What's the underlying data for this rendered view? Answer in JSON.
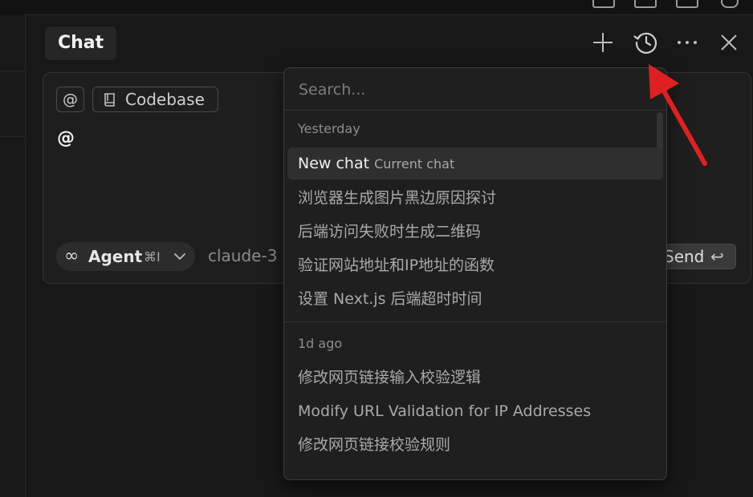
{
  "header": {
    "tab_title": "Chat",
    "icons": [
      "plus-icon",
      "history-icon",
      "more-icon",
      "close-icon"
    ]
  },
  "composer": {
    "mention_chip": "@",
    "codebase_chip": "Codebase",
    "typed_text": "@",
    "agent": {
      "label": "Agent",
      "shortcut": "⌘I"
    },
    "model": "claude-3",
    "send_label": "Send",
    "send_icon": "↩"
  },
  "history": {
    "search_placeholder": "Search...",
    "sections": [
      {
        "title": "Yesterday",
        "items": [
          {
            "label": "New chat",
            "sub": "Current chat"
          },
          {
            "label": "浏览器生成图片黑边原因探讨"
          },
          {
            "label": "后端访问失败时生成二维码"
          },
          {
            "label": "验证网站地址和IP地址的函数"
          },
          {
            "label": "设置 Next.js 后端超时时间"
          }
        ]
      },
      {
        "title": "1d ago",
        "items": [
          {
            "label": "修改网页链接输入校验逻辑"
          },
          {
            "label": "Modify URL Validation for IP Addresses"
          },
          {
            "label": "修改网页链接校验规则"
          }
        ]
      }
    ]
  },
  "colors": {
    "background": "#141414",
    "panel": "#181818",
    "dropdown": "#1f1f1f",
    "annotation_arrow": "#e02020"
  }
}
